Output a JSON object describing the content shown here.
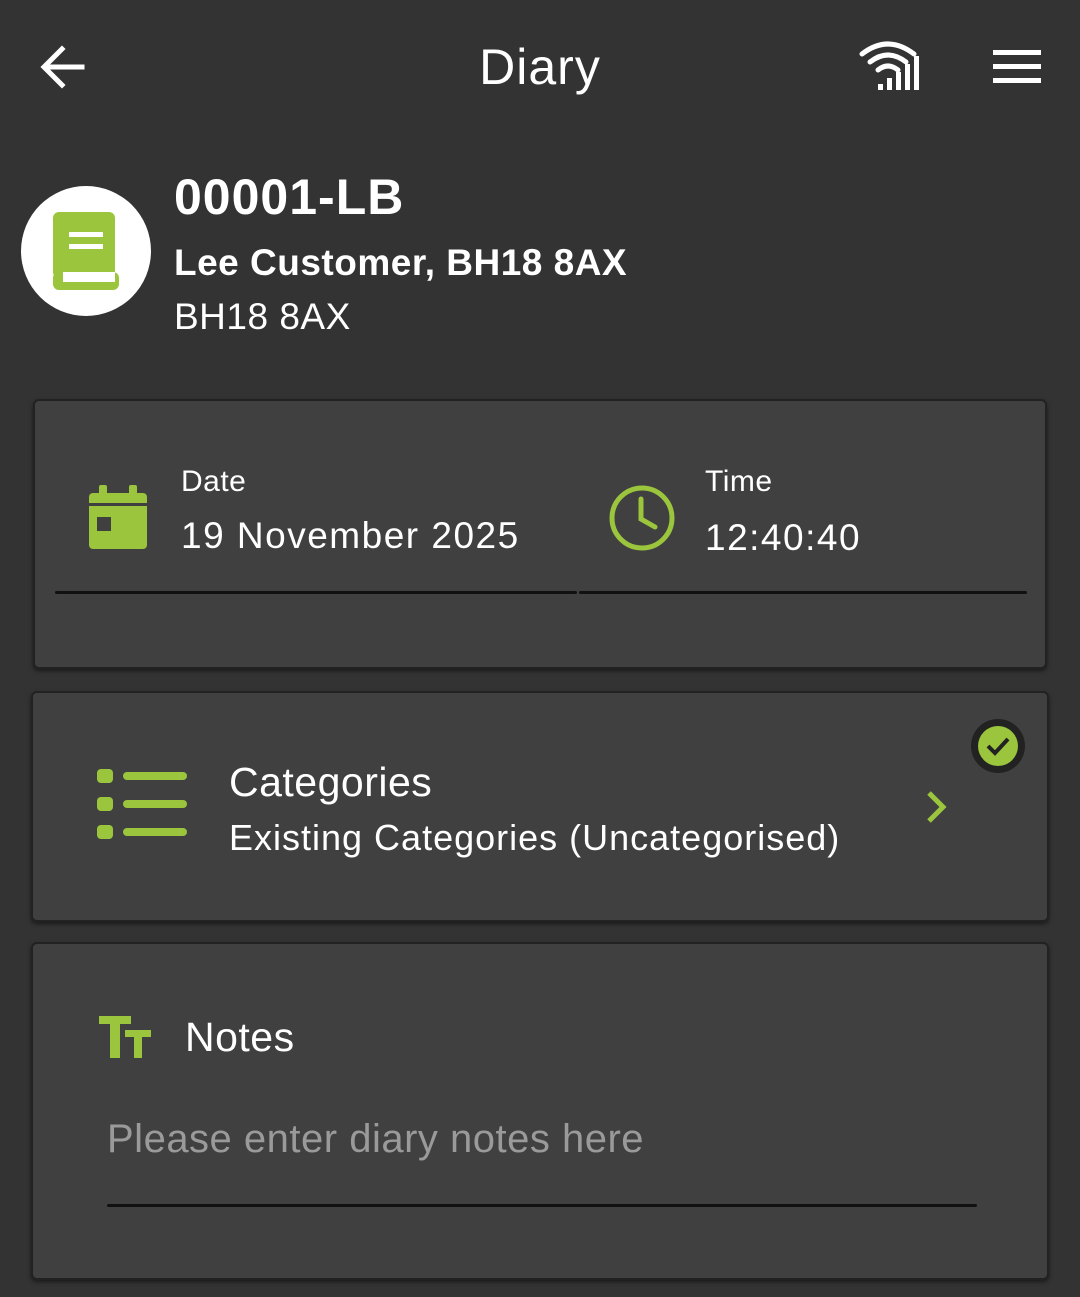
{
  "colors": {
    "accent": "#9bc53d",
    "background": "#333333",
    "card": "#404040"
  },
  "appbar": {
    "title": "Diary",
    "back_icon": "arrow-left-icon",
    "signal_icon": "wifi-signal-icon",
    "menu_icon": "hamburger-menu-icon"
  },
  "header": {
    "icon": "diary-book-icon",
    "job_code": "00001-LB",
    "customer": "Lee Customer, BH18 8AX",
    "postcode": "BH18 8AX"
  },
  "datetime": {
    "date_label": "Date",
    "date_value": "19 November 2025",
    "time_label": "Time",
    "time_value": "12:40:40"
  },
  "categories": {
    "title": "Categories",
    "subtitle": "Existing Categories (Uncategorised)",
    "status": "complete"
  },
  "notes": {
    "title": "Notes",
    "placeholder": "Please enter diary notes here",
    "value": ""
  }
}
